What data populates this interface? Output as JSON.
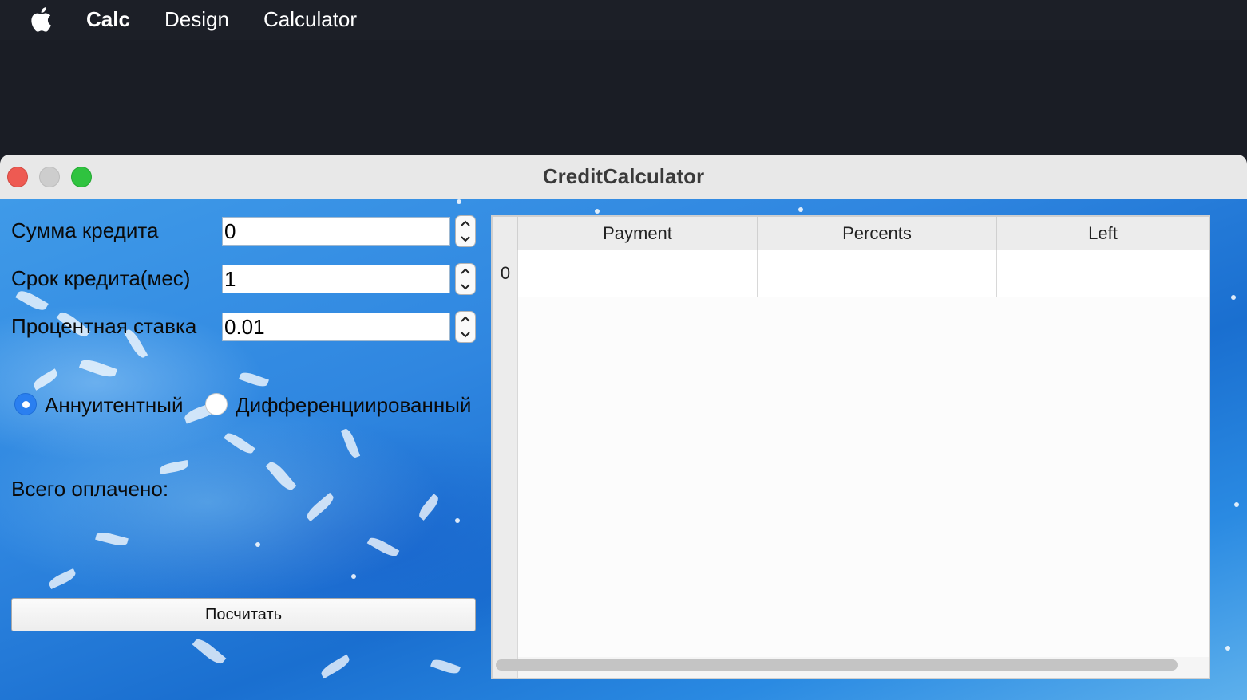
{
  "menubar": {
    "app_name": "Calc",
    "menus": [
      "Design",
      "Calculator"
    ]
  },
  "window": {
    "title": "CreditCalculator"
  },
  "form": {
    "amount_label": "Сумма кредита",
    "amount_value": "0",
    "term_label": "Срок кредита(мес)",
    "term_value": "1",
    "rate_label": "Процентная ставка",
    "rate_value": "0.01",
    "radio_annuity": "Аннуитентный",
    "radio_differentiated": "Дифференциированный",
    "selected_payment_type": "Аннуитентный",
    "total_paid_label": "Всего оплачено:",
    "calculate_button": "Посчитать"
  },
  "table": {
    "columns": [
      "Payment",
      "Percents",
      "Left"
    ],
    "rows": [
      {
        "index": "0",
        "cells": [
          "",
          "",
          ""
        ]
      }
    ]
  },
  "colors": {
    "accent": "#2a7ff0",
    "close": "#ee5a52",
    "minimize": "#cdcdcd",
    "maximize": "#2fc33f"
  }
}
